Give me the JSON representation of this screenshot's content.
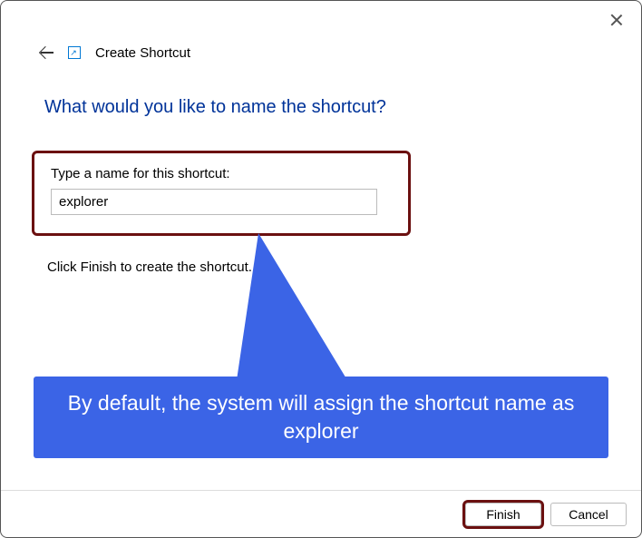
{
  "header": {
    "title": "Create Shortcut"
  },
  "content": {
    "question": "What would you like to name the shortcut?",
    "input_label": "Type a name for this shortcut:",
    "input_value": "explorer",
    "instruction": "Click Finish to create the shortcut."
  },
  "callout": {
    "text": "By default, the system will assign the shortcut name as explorer"
  },
  "footer": {
    "finish_label": "Finish",
    "cancel_label": "Cancel"
  },
  "colors": {
    "highlight_border": "#6b1010",
    "callout_bg": "#3b64e6",
    "heading": "#003399"
  }
}
